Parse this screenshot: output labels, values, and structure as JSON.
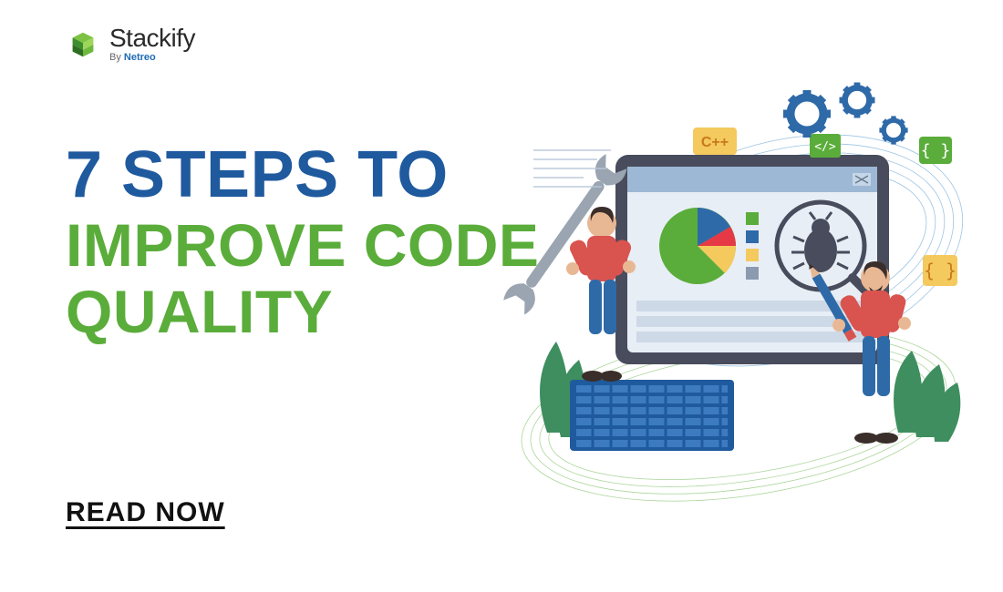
{
  "brand": {
    "name": "Stackify",
    "byline_prefix": "By ",
    "byline_company": "Netreo"
  },
  "headline": {
    "line1": "7 STEPS TO",
    "line2_a": "IMPROVE CODE",
    "line2_b": "QUALITY"
  },
  "cta": {
    "label": "READ NOW"
  },
  "illustration": {
    "badge_cpp": "C++",
    "badge_code": "</>",
    "badge_braces": "{ }"
  },
  "colors": {
    "blue": "#1f5a9e",
    "green": "#5aad3a",
    "dark": "#111111"
  }
}
